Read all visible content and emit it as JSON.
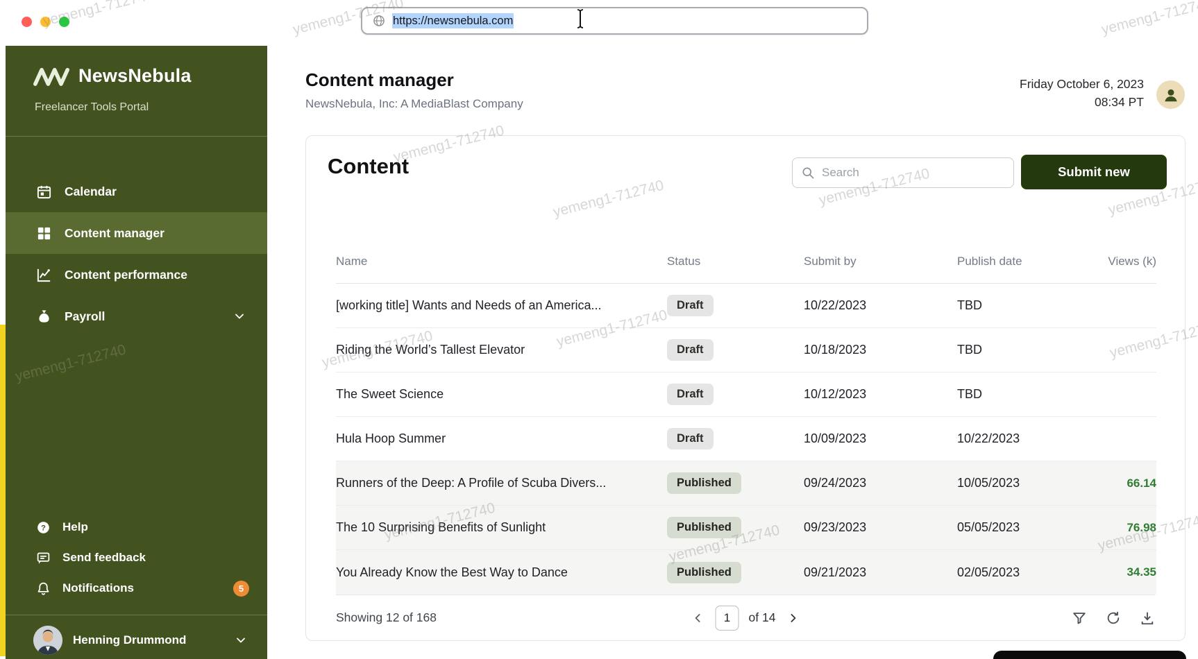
{
  "browser": {
    "url": "https://newsnebula.com"
  },
  "watermark": {
    "text": "yemeng1-712740"
  },
  "sidebar": {
    "logo_title": "NewsNebula",
    "logo_subtitle": "Freelancer Tools Portal",
    "nav": [
      {
        "label": "Calendar",
        "icon": "calendar-icon",
        "active": false
      },
      {
        "label": "Content manager",
        "icon": "grid-icon",
        "active": true
      },
      {
        "label": "Content performance",
        "icon": "line-chart-icon",
        "active": false
      },
      {
        "label": "Payroll",
        "icon": "money-bag-icon",
        "active": false,
        "expandable": true
      }
    ],
    "bottom_nav": [
      {
        "label": "Help",
        "icon": "help-icon"
      },
      {
        "label": "Send feedback",
        "icon": "feedback-icon"
      },
      {
        "label": "Notifications",
        "icon": "bell-icon",
        "badge": "5"
      }
    ],
    "user": {
      "name": "Henning Drummond"
    }
  },
  "header": {
    "title": "Content manager",
    "subtitle": "NewsNebula, Inc: A MediaBlast Company",
    "date": "Friday October 6, 2023",
    "time": "08:34 PT"
  },
  "content": {
    "heading": "Content",
    "search_placeholder": "Search",
    "submit_button": "Submit new",
    "table": {
      "columns": [
        "Name",
        "Status",
        "Submit by",
        "Publish date",
        "Views (k)"
      ],
      "rows": [
        {
          "name": "[working title] Wants and Needs of an America...",
          "status": "Draft",
          "submit_by": "10/22/2023",
          "publish_date": "TBD",
          "views": ""
        },
        {
          "name": "Riding the World’s Tallest Elevator",
          "status": "Draft",
          "submit_by": "10/18/2023",
          "publish_date": "TBD",
          "views": ""
        },
        {
          "name": "The Sweet Science",
          "status": "Draft",
          "submit_by": "10/12/2023",
          "publish_date": "TBD",
          "views": ""
        },
        {
          "name": "Hula Hoop Summer",
          "status": "Draft",
          "submit_by": "10/09/2023",
          "publish_date": "10/22/2023",
          "views": ""
        },
        {
          "name": "Runners of the Deep: A Profile of Scuba Divers...",
          "status": "Published",
          "submit_by": "09/24/2023",
          "publish_date": "10/05/2023",
          "views": "66.14"
        },
        {
          "name": "The 10 Surprising Benefits of Sunlight",
          "status": "Published",
          "submit_by": "09/23/2023",
          "publish_date": "05/05/2023",
          "views": "76.98"
        },
        {
          "name": "You Already Know the Best Way to Dance",
          "status": "Published",
          "submit_by": "09/21/2023",
          "publish_date": "02/05/2023",
          "views": "34.35"
        }
      ]
    },
    "footer": {
      "showing": "Showing 12 of 168",
      "page": "1",
      "of": "of 14"
    }
  },
  "icons": {
    "url_bar": "globe-icon",
    "search": "magnifier-icon",
    "nav": [
      "calendar-icon",
      "grid-icon",
      "line-chart-icon",
      "money-bag-icon"
    ],
    "bottom_nav": [
      "help-icon",
      "feedback-icon",
      "bell-icon"
    ],
    "footer": [
      "filter-icon",
      "refresh-icon",
      "download-icon"
    ],
    "pagination": [
      "chevron-left-icon",
      "chevron-right-icon"
    ]
  },
  "colors": {
    "sidebar_green": "#43531f",
    "sidebar_active_green": "#5a6b31",
    "submit_button_green": "#24390e",
    "views_green": "#2e7d32",
    "notification_orange": "#ee8b35",
    "url_selection_blue": "#b3d4fc",
    "desktop_strip_yellow": "#f2d31f",
    "draft_badge_bg": "#e4e5e4",
    "published_badge_bg": "#d7dcd1"
  }
}
